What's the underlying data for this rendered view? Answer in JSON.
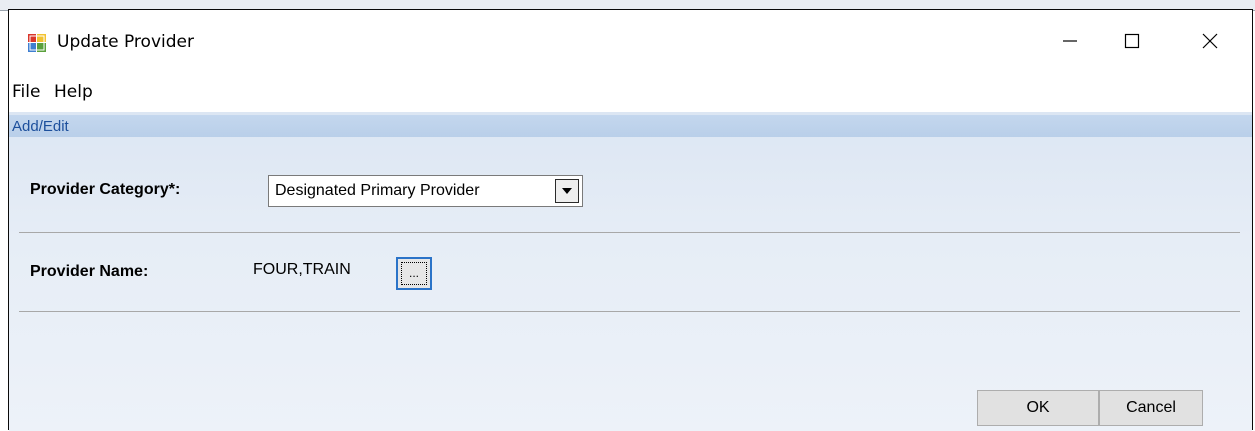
{
  "window": {
    "title": "Update Provider"
  },
  "menu": {
    "items": [
      "File",
      "Help"
    ]
  },
  "panel": {
    "header": "Add/Edit"
  },
  "form": {
    "provider_category_label": "Provider Category*:",
    "provider_category_value": "Designated Primary Provider",
    "provider_name_label": "Provider Name:",
    "provider_name_value": "FOUR,TRAIN",
    "browse_label": "..."
  },
  "buttons": {
    "ok": "OK",
    "cancel": "Cancel"
  },
  "colors": {
    "panel_header_text": "#1c4f9c",
    "focus_border": "#2a73c8",
    "panel_bg": "#e6edf6"
  },
  "icons": {
    "app": "app-window-icon",
    "minimize": "minimize-icon",
    "maximize": "maximize-icon",
    "close": "close-icon",
    "dropdown": "chevron-down-icon"
  }
}
